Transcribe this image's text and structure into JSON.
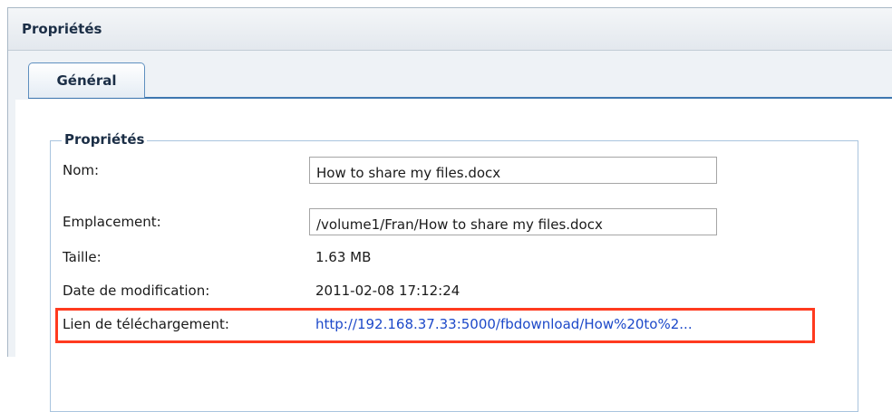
{
  "window": {
    "title": "Propriétés"
  },
  "tabs": [
    {
      "label": "Général",
      "active": true
    }
  ],
  "group": {
    "legend": "Propriétés"
  },
  "fields": {
    "name": {
      "label": "Nom:",
      "value": "How to share my files.docx"
    },
    "location": {
      "label": "Emplacement:",
      "value": "/volume1/Fran/How to share my files.docx"
    },
    "size": {
      "label": "Taille:",
      "value": "1.63 MB"
    },
    "modified": {
      "label": "Date de modification:",
      "value": "2011-02-08 17:12:24"
    },
    "download_link": {
      "label": "Lien de téléchargement:",
      "value": "http://192.168.37.33:5000/fbdownload/How%20to%2..."
    }
  },
  "colors": {
    "highlight": "#ff3a1f",
    "link": "#1d49c9",
    "tab_border": "#3f78b0"
  }
}
